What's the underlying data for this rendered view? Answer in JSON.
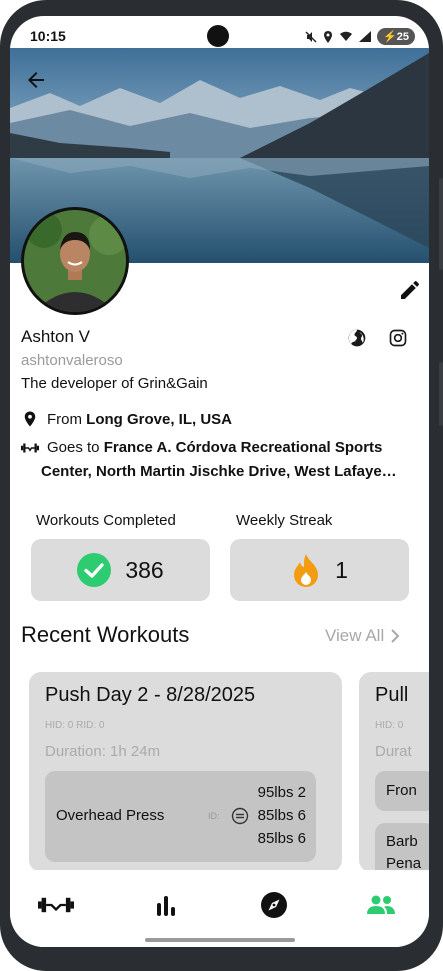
{
  "status_bar": {
    "time": "10:15",
    "battery": "25",
    "signal_label": "5"
  },
  "profile": {
    "name": "Ashton V",
    "username": "ashtonvaleroso",
    "bio": "The developer of Grin&Gain",
    "location_prefix": "From ",
    "location": "Long Grove, IL, USA",
    "gym_prefix": "Goes to ",
    "gym_line1": "France A. Córdova Recreational Sports",
    "gym_line2": "Center, North Martin Jischke Drive, West Lafaye…"
  },
  "stats": {
    "workouts_label": "Workouts Completed",
    "workouts_value": "386",
    "streak_label": "Weekly Streak",
    "streak_value": "1"
  },
  "recent": {
    "title": "Recent Workouts",
    "view_all": "View All",
    "cards": [
      {
        "title": "Push Day 2 - 8/28/2025",
        "ids": "HID: 0 RID: 0",
        "duration": "Duration: 1h 24m",
        "exercise": {
          "name": "Overhead Press",
          "id_label": "ID:",
          "sets": [
            "95lbs 2",
            "85lbs 6",
            "85lbs 6"
          ]
        }
      },
      {
        "title": "Pull",
        "ids": "HID: 0",
        "duration": "Durat",
        "exercise_1": "Fron",
        "exercise_2_line1": "Barb",
        "exercise_2_line2": "Pena"
      }
    ]
  },
  "colors": {
    "accent_green": "#2ecc71",
    "flame_orange": "#f39c12",
    "card_gray": "#dcdcdc",
    "inner_gray": "#c4c4c4"
  },
  "nav": {
    "items": [
      "dumbbell-icon",
      "bar-chart-icon",
      "compass-icon",
      "people-icon"
    ],
    "active": "people-icon"
  }
}
